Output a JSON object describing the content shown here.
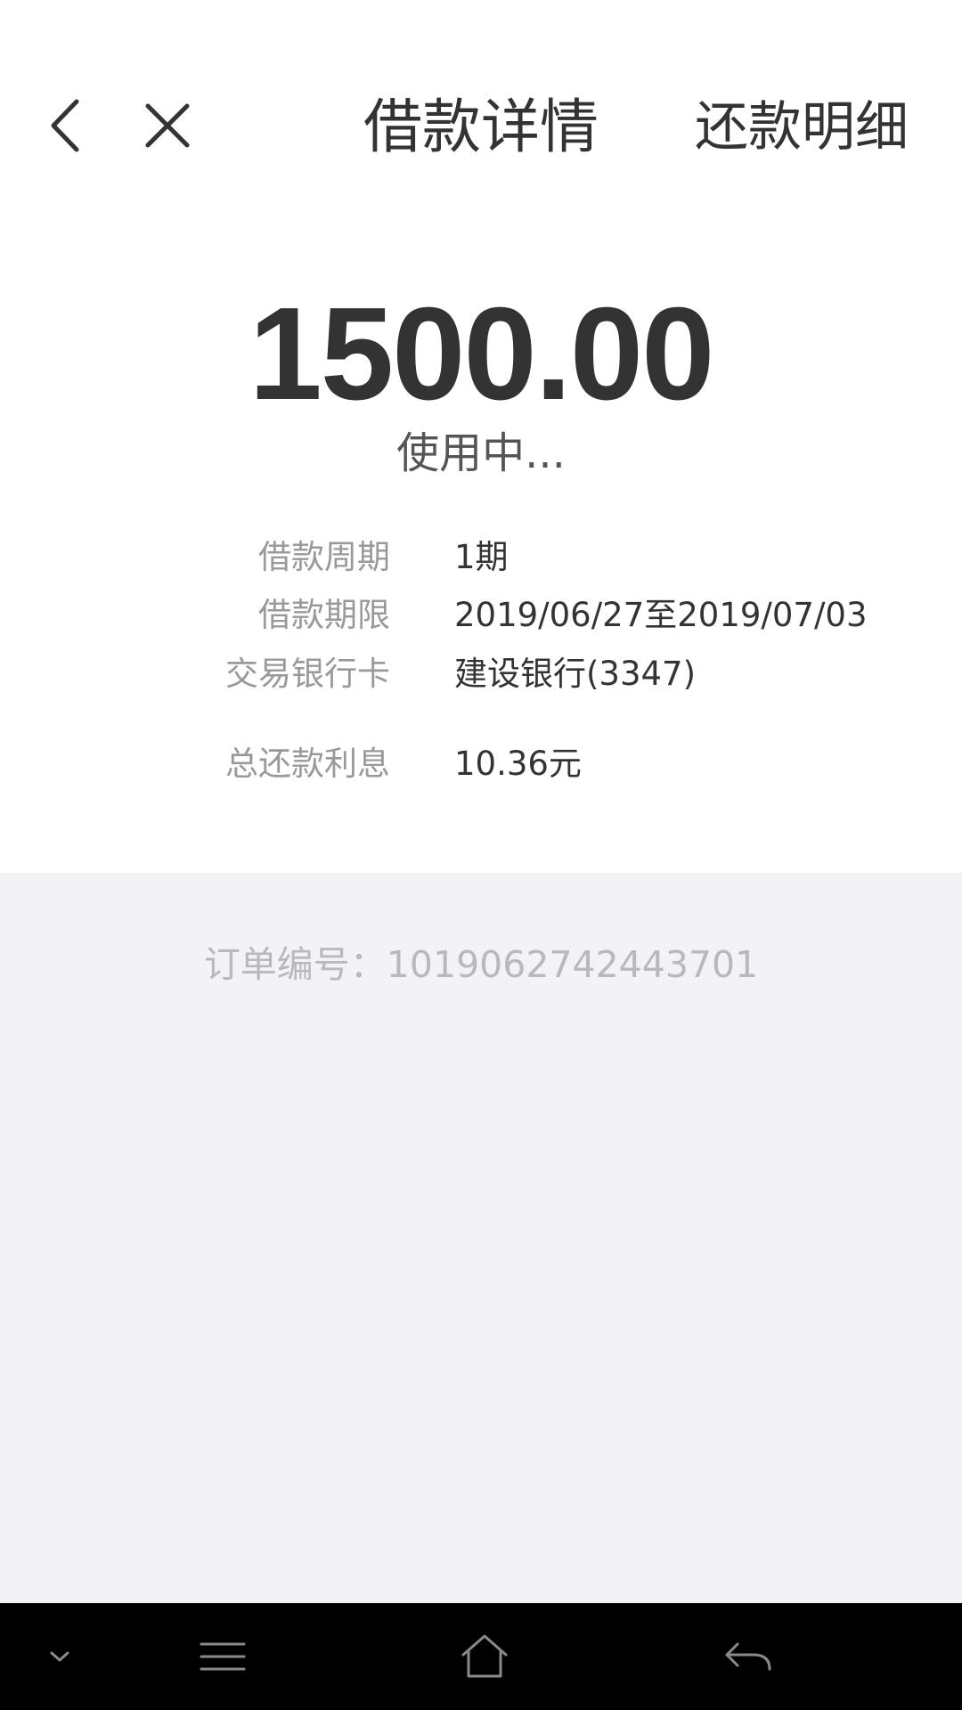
{
  "header": {
    "title": "借款详情",
    "repay_detail_label": "还款明细",
    "back_icon": "chevron-left-icon",
    "close_icon": "close-icon"
  },
  "summary": {
    "amount": "1500.00",
    "status": "使用中..."
  },
  "details": [
    {
      "label": "借款周期",
      "value": "1期"
    },
    {
      "label": "借款期限",
      "value": "2019/06/27至2019/07/03"
    },
    {
      "label": "交易银行卡",
      "value": "建设银行(3347)"
    },
    {
      "label": "总还款利息",
      "value": "10.36元"
    }
  ],
  "order": {
    "text": "订单编号：1019062742443701"
  },
  "navbar": {
    "icons": [
      "chevron-down-icon",
      "menu-icon",
      "home-icon",
      "back-arrow-icon"
    ]
  },
  "colors": {
    "text_primary": "#333333",
    "text_secondary": "#999999",
    "background_grey": "#f3f3f7",
    "navbar": "#000000"
  }
}
